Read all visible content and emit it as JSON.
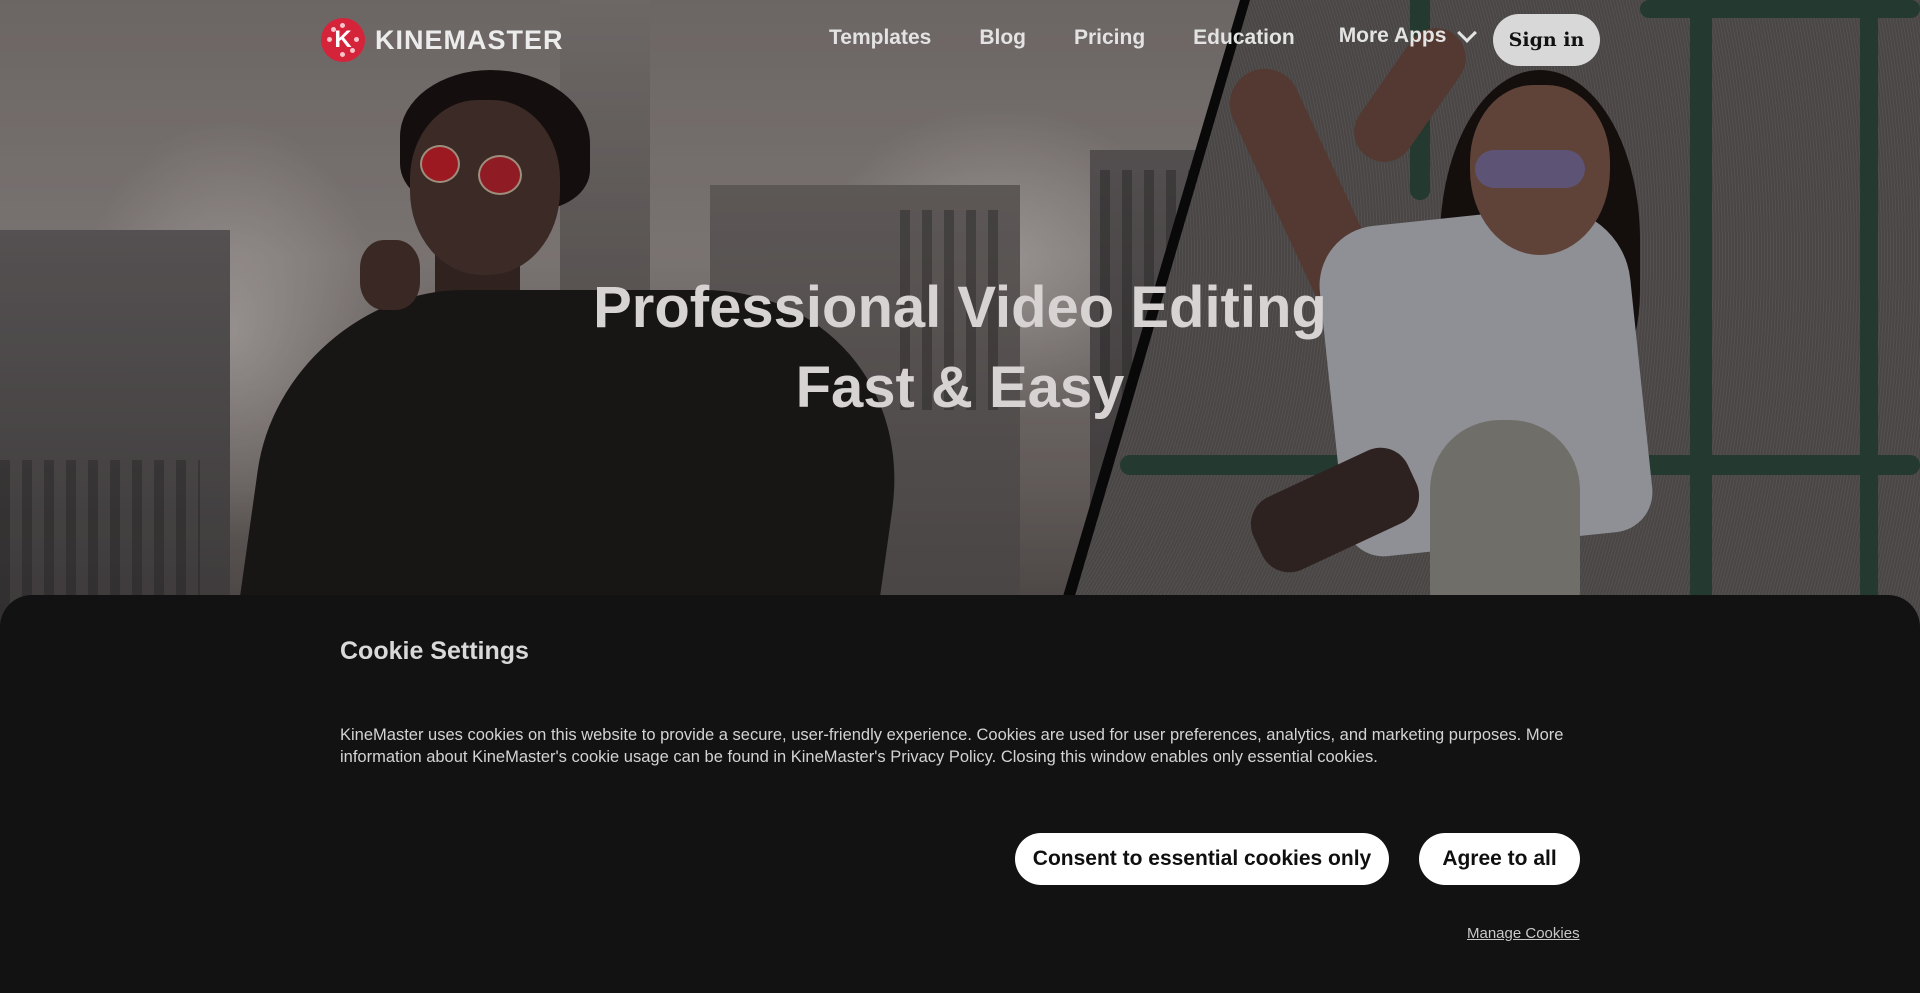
{
  "nav": {
    "logo_letter": "K",
    "logo_text": "KINEMASTER",
    "links": [
      "Templates",
      "Blog",
      "Pricing",
      "Education"
    ],
    "more_apps": "More Apps",
    "sign_in": "Sign in"
  },
  "hero": {
    "title_line1": "Professional Video Editing",
    "title_line2": "Fast & Easy"
  },
  "cookie": {
    "title": "Cookie Settings",
    "body": "KineMaster uses cookies on this website to provide a secure, user-friendly experience. Cookies are used for user preferences, analytics, and marketing purposes. More information about KineMaster's cookie usage can be found in KineMaster's Privacy Policy. Closing this window enables only essential cookies.",
    "essential_button": "Consent to essential cookies only",
    "agree_button": "Agree to all",
    "manage_link": "Manage Cookies"
  },
  "colors": {
    "brand_red": "#d5243a",
    "panel_bg": "#121212",
    "button_bg": "#ffffff"
  },
  "icons": {
    "logo": "kinemaster-logo-icon",
    "more_apps": "chevron-down-icon"
  }
}
